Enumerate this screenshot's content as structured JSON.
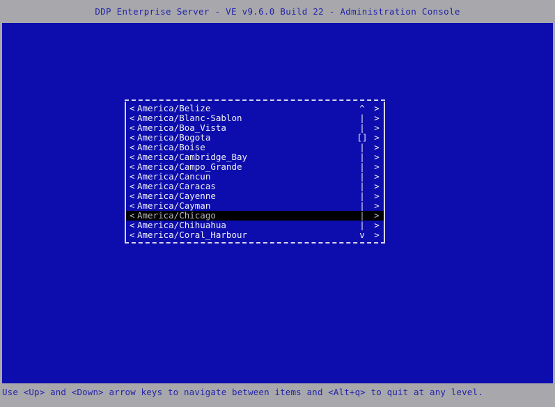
{
  "window": {
    "title": "DDP Enterprise Server - VE v9.6.0 Build 22 - Administration Console"
  },
  "colors": {
    "screen_background": "#a8a8ac",
    "canvas_background": "#0d0dae",
    "title_text": "#2222a8",
    "list_text": "#f0f0f5",
    "selection_background": "#000000",
    "selection_text": "#b9b9bd",
    "border": "#d6d6e8"
  },
  "menu": {
    "left_marker": "<",
    "right_marker": ">",
    "scroll_up_glyph": "^",
    "scroll_down_glyph": "v",
    "scroll_track_glyph": "|",
    "scroll_thumb_glyph": "[]",
    "selected_index": 11,
    "items": [
      {
        "label": "America/Belize",
        "scroll": "^"
      },
      {
        "label": "America/Blanc-Sablon",
        "scroll": "|"
      },
      {
        "label": "America/Boa_Vista",
        "scroll": "|"
      },
      {
        "label": "America/Bogota",
        "scroll": "[]"
      },
      {
        "label": "America/Boise",
        "scroll": "|"
      },
      {
        "label": "America/Cambridge_Bay",
        "scroll": "|"
      },
      {
        "label": "America/Campo_Grande",
        "scroll": "|"
      },
      {
        "label": "America/Cancun",
        "scroll": "|"
      },
      {
        "label": "America/Caracas",
        "scroll": "|"
      },
      {
        "label": "America/Cayenne",
        "scroll": "|"
      },
      {
        "label": "America/Cayman",
        "scroll": "|"
      },
      {
        "label": "America/Chicago",
        "scroll": "|"
      },
      {
        "label": "America/Chihuahua",
        "scroll": "|"
      },
      {
        "label": "America/Coral_Harbour",
        "scroll": "v"
      }
    ]
  },
  "statusbar": {
    "hint": "Use <Up> and <Down> arrow keys to navigate between items and <Alt+q> to quit at any level."
  }
}
